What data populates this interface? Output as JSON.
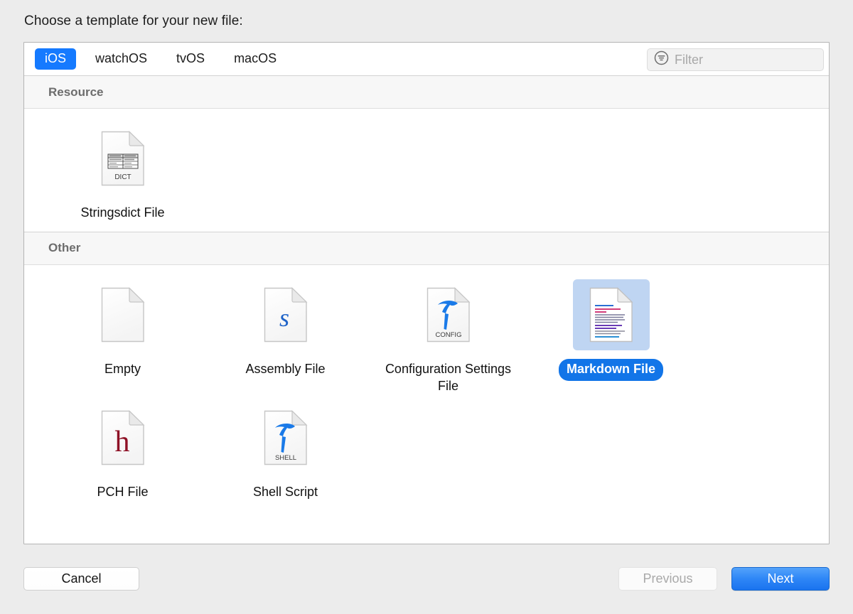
{
  "dialog": {
    "title": "Choose a template for your new file:"
  },
  "tabs": [
    {
      "label": "iOS",
      "active": true
    },
    {
      "label": "watchOS",
      "active": false
    },
    {
      "label": "tvOS",
      "active": false
    },
    {
      "label": "macOS",
      "active": false
    }
  ],
  "filter": {
    "placeholder": "Filter",
    "value": "",
    "icon": "filter-circle-icon"
  },
  "sections": [
    {
      "header": "Resource",
      "items": [
        {
          "label": "Stringsdict File",
          "icon": "dict-document-icon",
          "badge": "DICT",
          "selected": false
        }
      ]
    },
    {
      "header": "Other",
      "items": [
        {
          "label": "Empty",
          "icon": "empty-document-icon",
          "badge": "",
          "selected": false
        },
        {
          "label": "Assembly File",
          "icon": "assembly-document-icon",
          "badge": "s",
          "selected": false
        },
        {
          "label": "Configuration Settings File",
          "icon": "config-document-icon",
          "badge": "CONFIG",
          "selected": false
        },
        {
          "label": "Markdown File",
          "icon": "markdown-document-icon",
          "badge": "",
          "selected": true
        },
        {
          "label": "PCH File",
          "icon": "pch-document-icon",
          "badge": "h",
          "selected": false
        },
        {
          "label": "Shell Script",
          "icon": "shell-document-icon",
          "badge": "SHELL",
          "selected": false
        }
      ]
    }
  ],
  "footer": {
    "cancel_label": "Cancel",
    "previous_label": "Previous",
    "next_label": "Next"
  },
  "colors": {
    "accent": "#157aff",
    "selection_fill": "#bfd5f2",
    "selected_pill": "#1275e8",
    "section_header_text": "#6d6d6d"
  }
}
